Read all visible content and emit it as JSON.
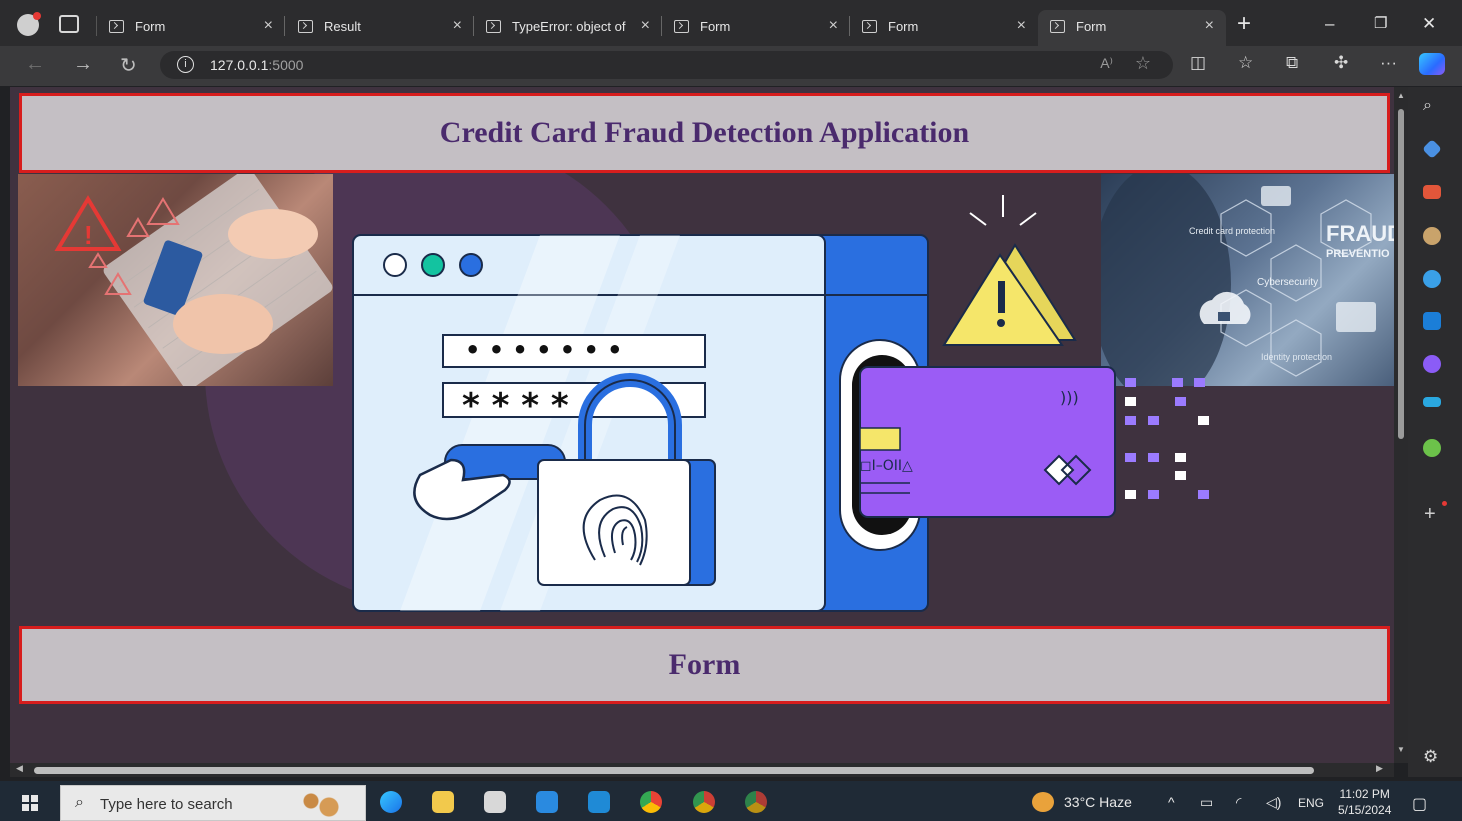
{
  "browser": {
    "tabs": [
      {
        "title": "Form",
        "active": false
      },
      {
        "title": "Result",
        "active": false
      },
      {
        "title": "TypeError: object of t",
        "active": false
      },
      {
        "title": "Form",
        "active": false
      },
      {
        "title": "Form",
        "active": false
      },
      {
        "title": "Form",
        "active": true
      }
    ],
    "new_tab_label": "+",
    "close_glyph": "×",
    "window_controls": {
      "minimize": "–",
      "restore": "❐",
      "close": "✕"
    },
    "address": {
      "host": "127.0.0.1",
      "port": ":5000"
    },
    "nav_icons": [
      "back-icon",
      "forward-icon",
      "refresh-icon"
    ],
    "toolbar_icons": [
      "read-aloud-icon",
      "favorite-star-icon",
      "split-screen-icon",
      "favorites-icon",
      "collections-icon",
      "extensions-icon",
      "more-icon",
      "copilot-icon"
    ]
  },
  "page": {
    "header_title": "Credit Card Fraud Detection Application",
    "section_title": "Form",
    "illustration": {
      "password_dots": "• • • • • • •",
      "password_stars": "* * * *",
      "card_symbols": "◻I–OII△",
      "card_contactless": ")))"
    },
    "right_photo_text": {
      "fraud": "FRAUD",
      "prevention": "PREVENTIO",
      "cybersecurity": "Cybersecurity",
      "credit_card_protection": "Credit card protection",
      "identity_protection": "Identity protection"
    }
  },
  "sidebar_icons": [
    "search-icon",
    "tag-icon",
    "toolbox-icon",
    "people-icon",
    "copilot-circle-icon",
    "outlook-icon",
    "games-icon",
    "telegram-icon",
    "tree-icon",
    "add-icon",
    "settings-icon"
  ],
  "taskbar": {
    "search_placeholder": "Type here to search",
    "weather": "33°C  Haze",
    "language": "ENG",
    "time": "11:02 PM",
    "date": "5/15/2024"
  },
  "colors": {
    "page_background": "#3f323f",
    "banner_fill": "#c4bfc4",
    "banner_border": "#d71d1d",
    "banner_text": "#4a2a6d",
    "illustration_blue": "#2a6fe0",
    "card_purple": "#9b5cf5",
    "warning_yellow": "#f5e66a"
  }
}
